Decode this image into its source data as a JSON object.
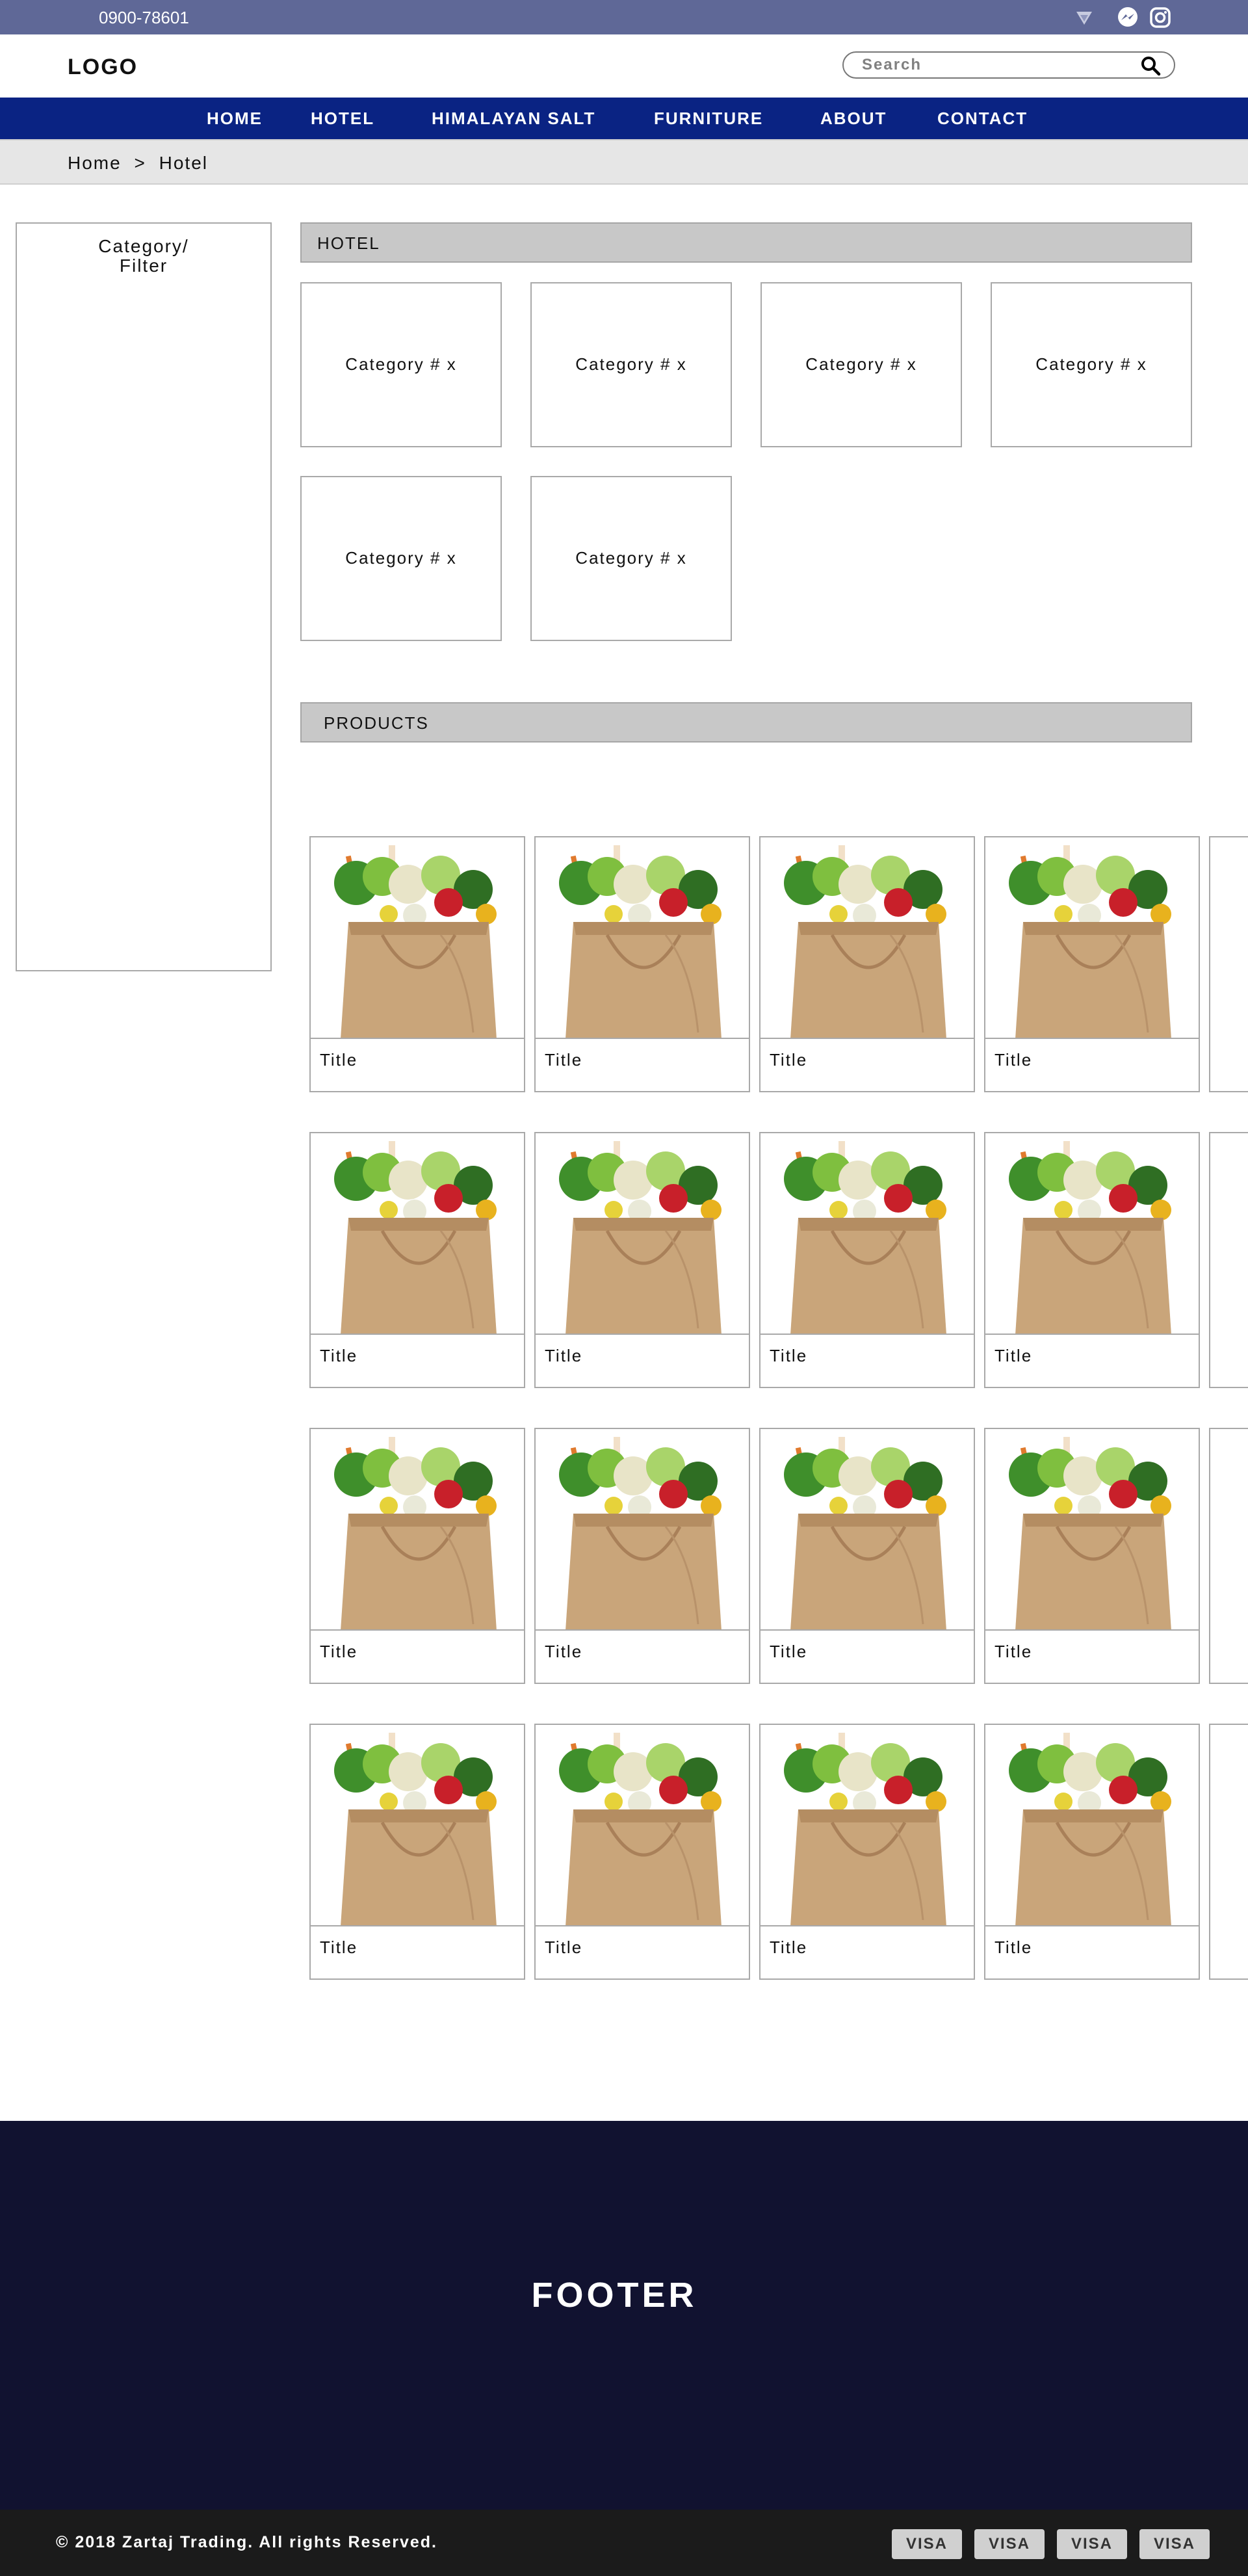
{
  "topbar": {
    "phone": "0900-78601",
    "social_icons": [
      "signal-icon",
      "messenger-icon",
      "instagram-icon"
    ]
  },
  "header": {
    "logo": "LOGO",
    "search": {
      "placeholder": "Search"
    }
  },
  "nav": {
    "items": [
      {
        "label": "HOME"
      },
      {
        "label": "HOTEL"
      },
      {
        "label": "HIMALAYAN SALT"
      },
      {
        "label": "FURNITURE"
      },
      {
        "label": "ABOUT"
      },
      {
        "label": "CONTACT"
      }
    ]
  },
  "breadcrumb": {
    "items": [
      "Home",
      "Hotel"
    ],
    "separator": ">"
  },
  "sidebar": {
    "title_line1": "Category/",
    "title_line2": "Filter"
  },
  "sections": {
    "hotel": "HOTEL",
    "products": "PRODUCTS"
  },
  "categories": [
    {
      "label": "Category # x"
    },
    {
      "label": "Category # x"
    },
    {
      "label": "Category # x"
    },
    {
      "label": "Category # x"
    },
    {
      "label": "Category # x"
    },
    {
      "label": "Category # x"
    }
  ],
  "products": {
    "rows": [
      [
        "Title",
        "Title",
        "Title",
        "Title"
      ],
      [
        "Title",
        "Title",
        "Title",
        "Title"
      ],
      [
        "Title",
        "Title",
        "Title",
        "Title"
      ],
      [
        "Title",
        "Title",
        "Title",
        "Title"
      ]
    ],
    "image": "grocery-bag-image"
  },
  "footer": {
    "label": "FOOTER",
    "copyright": "© 2018 Zartaj Trading. All rights Reserved.",
    "payment_badges": [
      "VISA",
      "VISA",
      "VISA",
      "VISA"
    ]
  },
  "colors": {
    "topbar": "#5f6897",
    "nav": "#0a2383",
    "footer": "#111230",
    "bottombar": "#1b1b1b"
  }
}
